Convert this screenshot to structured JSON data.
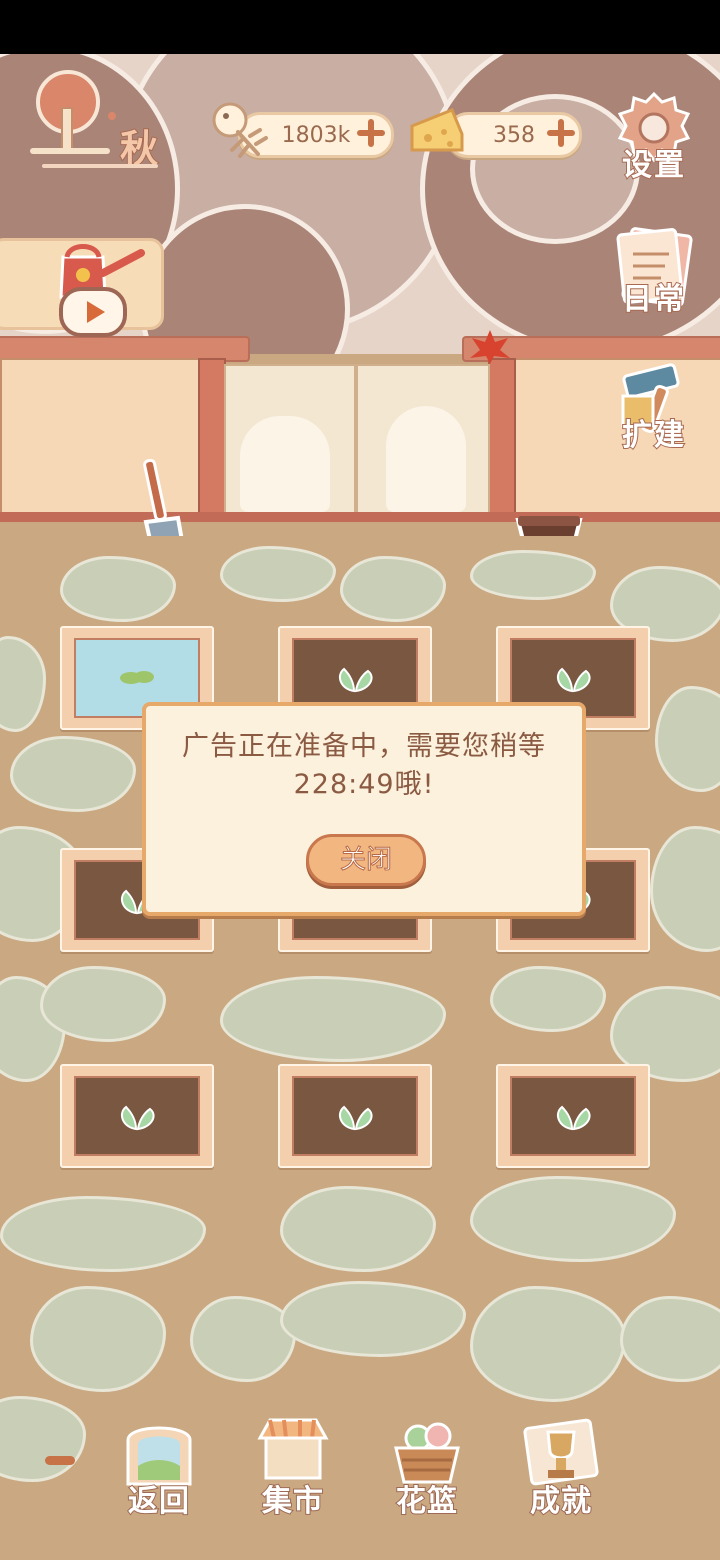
{
  "hud": {
    "season": "秋",
    "fish_currency": "1803k",
    "cheese_currency": "358"
  },
  "side_buttons": {
    "settings": "设置",
    "daily": "日常",
    "build": "扩建"
  },
  "dialog": {
    "message": "广告正在准备中，需要您稍等228:49哦!",
    "close_label": "关闭"
  },
  "nav": {
    "back": "返回",
    "market": "集市",
    "basket": "花篮",
    "achievements": "成就"
  },
  "colors": {
    "ground": "#caa982",
    "dialog_bg": "#fbf1dc",
    "dialog_border": "#e7a96a",
    "button_orange": "#f2b681",
    "soil": "#7a5741"
  },
  "icons": {
    "fish": "fish-bone-icon",
    "cheese": "cheese-icon",
    "plus": "plus-icon",
    "gear": "gear-icon",
    "daily_note": "note-icon",
    "hammer": "hammer-icon",
    "watering_can": "watering-can-icon",
    "play": "play-icon",
    "shovel": "shovel-icon",
    "bowl": "bowl-icon",
    "sprout": "sprout-icon"
  }
}
